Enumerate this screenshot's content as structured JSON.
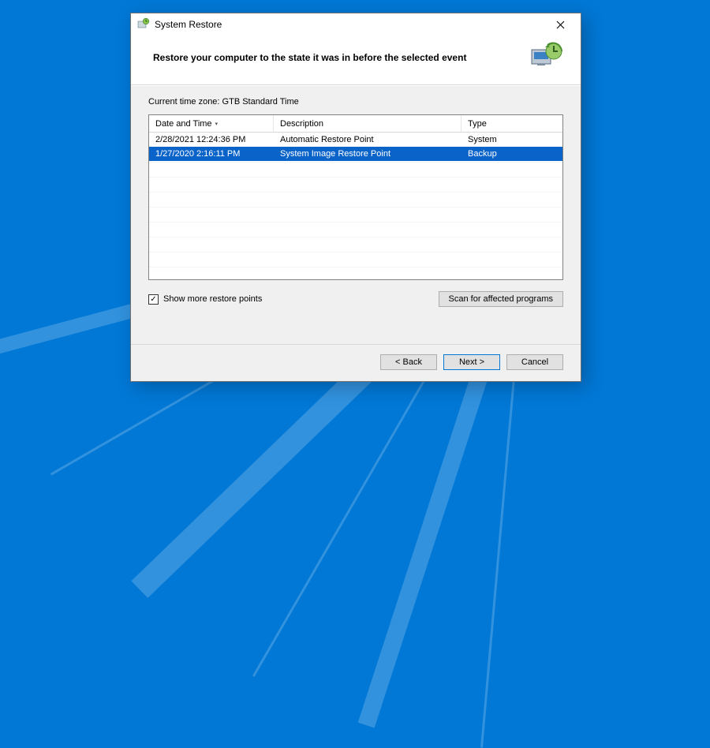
{
  "window": {
    "title": "System Restore",
    "heading": "Restore your computer to the state it was in before the selected event"
  },
  "timezone_label": "Current time zone: GTB Standard Time",
  "table": {
    "columns": {
      "date": "Date and Time",
      "desc": "Description",
      "type": "Type"
    },
    "rows": [
      {
        "date": "2/28/2021 12:24:36 PM",
        "desc": "Automatic Restore Point",
        "type": "System",
        "selected": false
      },
      {
        "date": "1/27/2020 2:16:11 PM",
        "desc": "System Image Restore Point",
        "type": "Backup",
        "selected": true
      }
    ]
  },
  "checkbox": {
    "label": "Show more restore points",
    "checked": true
  },
  "buttons": {
    "scan": "Scan for affected programs",
    "back": "< Back",
    "next": "Next >",
    "cancel": "Cancel"
  }
}
